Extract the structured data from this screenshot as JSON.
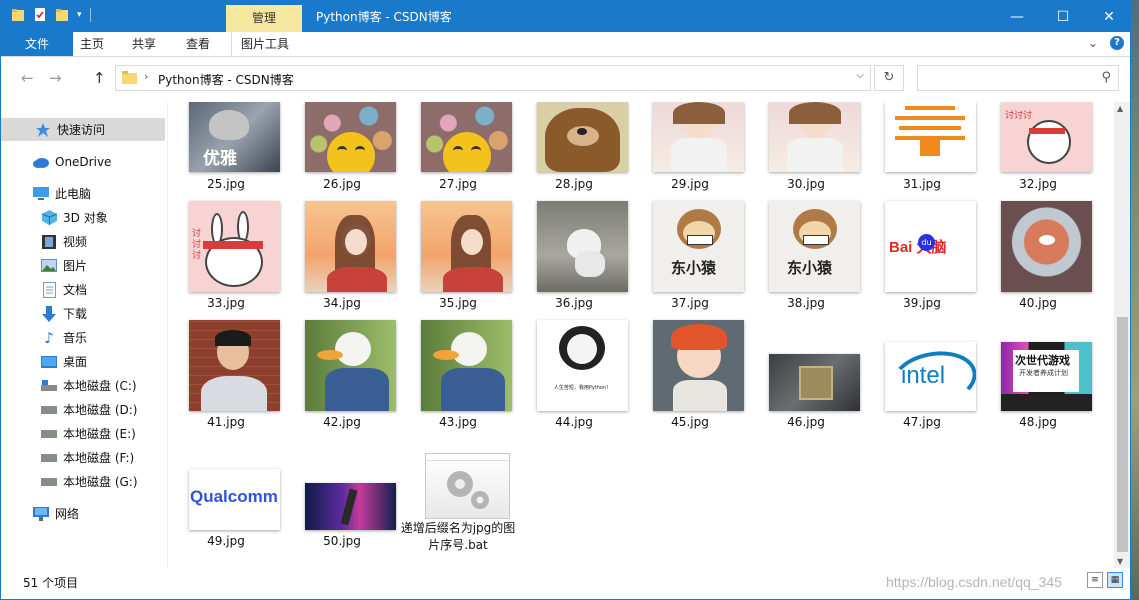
{
  "window": {
    "title": "Python博客 - CSDN博客",
    "context_tab": "管理",
    "controls": {
      "minimize": "—",
      "maximize": "☐",
      "close": "✕"
    }
  },
  "ribbon": {
    "tabs": [
      "文件",
      "主页",
      "共享",
      "查看",
      "图片工具"
    ],
    "collapse_glyph": "⌄",
    "help_glyph": "?"
  },
  "address": {
    "path": "Python博客 - CSDN博客",
    "chevron": "›",
    "dropdown": "⌵",
    "refresh": "↻",
    "search_placeholder": "",
    "search_glyph": "⚲"
  },
  "nav": {
    "back": "←",
    "forward": "→",
    "up": "↑",
    "items": [
      {
        "label": "快速访问",
        "icon": "star-icon"
      },
      {
        "label": "OneDrive",
        "icon": "cloud-icon"
      },
      {
        "label": "此电脑",
        "icon": "computer-icon"
      },
      {
        "label": "3D 对象",
        "icon": "cube-icon"
      },
      {
        "label": "视频",
        "icon": "film-icon"
      },
      {
        "label": "图片",
        "icon": "picture-icon"
      },
      {
        "label": "文档",
        "icon": "document-icon"
      },
      {
        "label": "下载",
        "icon": "download-icon"
      },
      {
        "label": "音乐",
        "icon": "music-icon"
      },
      {
        "label": "桌面",
        "icon": "desktop-icon"
      },
      {
        "label": "本地磁盘 (C:)",
        "icon": "drive-c-icon"
      },
      {
        "label": "本地磁盘 (D:)",
        "icon": "drive-icon"
      },
      {
        "label": "本地磁盘 (E:)",
        "icon": "drive-icon"
      },
      {
        "label": "本地磁盘 (F:)",
        "icon": "drive-icon"
      },
      {
        "label": "本地磁盘 (G:)",
        "icon": "drive-icon"
      },
      {
        "label": "网络",
        "icon": "network-icon"
      }
    ]
  },
  "files": [
    {
      "name": "25.jpg",
      "thumb": "cat-meme",
      "text": "优雅"
    },
    {
      "name": "26.jpg",
      "thumb": "emoji-toys"
    },
    {
      "name": "27.jpg",
      "thumb": "emoji-toys"
    },
    {
      "name": "28.jpg",
      "thumb": "bear"
    },
    {
      "name": "29.jpg",
      "thumb": "anime-girl-light"
    },
    {
      "name": "30.jpg",
      "thumb": "anime-girl-light"
    },
    {
      "name": "31.jpg",
      "thumb": "orange-logo"
    },
    {
      "name": "32.jpg",
      "thumb": "rabbit"
    },
    {
      "name": "33.jpg",
      "thumb": "rabbit"
    },
    {
      "name": "34.jpg",
      "thumb": "anime-girl-warm"
    },
    {
      "name": "35.jpg",
      "thumb": "anime-girl-warm"
    },
    {
      "name": "36.jpg",
      "thumb": "gray-cat"
    },
    {
      "name": "37.jpg",
      "thumb": "monkey-logo",
      "text": "东小猿"
    },
    {
      "name": "38.jpg",
      "thumb": "monkey-logo",
      "text": "东小猿"
    },
    {
      "name": "39.jpg",
      "thumb": "baidu-logo",
      "text": "Bai 大脑",
      "badge": "du"
    },
    {
      "name": "40.jpg",
      "thumb": "space-cat"
    },
    {
      "name": "41.jpg",
      "thumb": "portrait"
    },
    {
      "name": "42.jpg",
      "thumb": "duck"
    },
    {
      "name": "43.jpg",
      "thumb": "duck"
    },
    {
      "name": "44.jpg",
      "thumb": "panda-meme",
      "text": "人生苦短，我用Python！"
    },
    {
      "name": "45.jpg",
      "thumb": "anime-boy"
    },
    {
      "name": "46.jpg",
      "thumb": "cpu-chip"
    },
    {
      "name": "47.jpg",
      "thumb": "intel-logo",
      "text": "intel"
    },
    {
      "name": "48.jpg",
      "thumb": "game-banner",
      "text": "次世代游戏",
      "subtext": "开发者养成计划"
    },
    {
      "name": "49.jpg",
      "thumb": "qualcomm-logo",
      "text": "Qualcomm"
    },
    {
      "name": "50.jpg",
      "thumb": "neon-dancer"
    },
    {
      "name": "递增后缀名为jpg的图片序号.bat",
      "thumb": "bat-gears"
    }
  ],
  "status": {
    "item_count": "51 个项目",
    "watermark": "https://blog.csdn.net/qq_345"
  },
  "colors": {
    "accent": "#1979ca",
    "context_tab": "#f6e8a0",
    "selected_nav": "#d9d9d9"
  }
}
